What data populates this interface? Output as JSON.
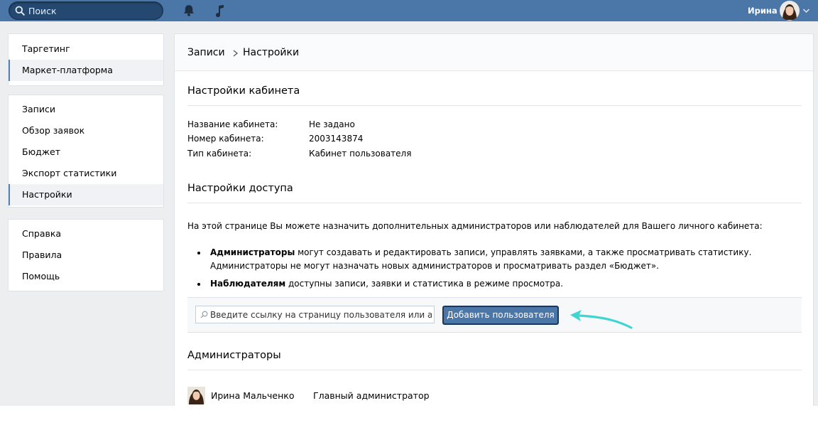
{
  "topbar": {
    "search_placeholder": "Поиск",
    "user_name": "Ирина",
    "icons": [
      "search-icon",
      "bell-icon",
      "music-icon",
      "chevron-down-icon"
    ],
    "accent_color": "#4a76a8"
  },
  "sidebar": {
    "group1": [
      {
        "label": "Таргетинг",
        "active": false
      },
      {
        "label": "Маркет-платформа",
        "active": true
      }
    ],
    "group2": [
      {
        "label": "Записи",
        "active": false
      },
      {
        "label": "Обзор заявок",
        "active": false
      },
      {
        "label": "Бюджет",
        "active": false
      },
      {
        "label": "Экспорт статистики",
        "active": false
      },
      {
        "label": "Настройки",
        "active": true
      }
    ],
    "group3": [
      {
        "label": "Справка",
        "active": false
      },
      {
        "label": "Правила",
        "active": false
      },
      {
        "label": "Помощь",
        "active": false
      }
    ]
  },
  "breadcrumb": {
    "parent": "Записи",
    "current": "Настройки"
  },
  "cabinet_settings": {
    "title": "Настройки кабинета",
    "fields": [
      {
        "label": "Название кабинета:",
        "value": "Не задано"
      },
      {
        "label": "Номер кабинета:",
        "value": "2003143874"
      },
      {
        "label": "Тип кабинета:",
        "value": "Кабинет пользователя"
      }
    ]
  },
  "access_settings": {
    "title": "Настройки доступа",
    "intro": "На этой странице Вы можете назначить дополнительных администраторов или наблюдателей для Вашего личного кабинета:",
    "admins_bold": "Администраторы",
    "admins_text_1": " могут создавать и редактировать записи, управлять заявками, а также просматривать статистику.",
    "admins_text_2": "Администраторы не могут назначать новых администраторов и просматривать раздел «Бюджет».",
    "observers_bold": "Наблюдателям",
    "observers_text": " доступны записи, заявки и статистика в режиме просмотра.",
    "input_placeholder": "Введите ссылку на страницу пользователя или адре...",
    "add_button": "Добавить пользователя"
  },
  "administrators": {
    "title": "Администраторы",
    "list": [
      {
        "name": "Ирина Мальченко",
        "role": "Главный администратор"
      }
    ]
  }
}
